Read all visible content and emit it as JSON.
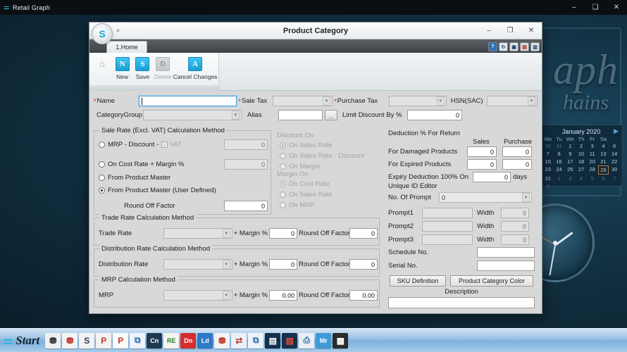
{
  "app_window": {
    "title": "Retail Graph",
    "icon": "app-logo-icon",
    "minimize": "–",
    "maximize": "❑",
    "close": "✕"
  },
  "dialog": {
    "title": "Product Category",
    "logo": "S",
    "qat_icon": "▾undefined",
    "qat": "≡",
    "minimize": "–",
    "maximize": "❐",
    "close": "✕",
    "tab": "1.Home",
    "tab_icons": [
      "help-icon",
      "refresh-icon",
      "save-icon",
      "report-icon",
      "window-icon"
    ],
    "tab_icon_labels": [
      "?",
      "↻",
      "▣",
      "▤",
      "▥"
    ]
  },
  "ribbon": {
    "home_icon": "⌂",
    "buttons": [
      {
        "glyph": "N",
        "label": "New",
        "disabled": false
      },
      {
        "glyph": "S",
        "label": "Save",
        "disabled": false
      },
      {
        "glyph": "D",
        "label": "Delete",
        "disabled": true
      },
      {
        "glyph": "A",
        "label": "Cancel Changes",
        "disabled": false
      }
    ]
  },
  "form": {
    "name": {
      "label": "Name",
      "value": "",
      "required": true
    },
    "sale_tax": {
      "label": "Sale Tax",
      "value": "",
      "required": true
    },
    "purchase_tax": {
      "label": "Purchase Tax",
      "value": "",
      "required": true
    },
    "hsn_sac": {
      "label": "HSN(SAC)",
      "value": ""
    },
    "category_group": {
      "label": "CategoryGroup",
      "value": ""
    },
    "alias": {
      "label": "Alias",
      "value": "",
      "browse": "..."
    },
    "limit_discount": {
      "label": "Limit Discount By %",
      "value": "0"
    }
  },
  "sale_rate": {
    "title": "Sale Rate (Excl. VAT) Calculation Method",
    "options": [
      {
        "label": "MRP - Discount -",
        "selected": false,
        "has_checkbox": true,
        "checkbox_label": "VAT",
        "checkbox_checked": true,
        "value": "0"
      },
      {
        "label": "On Cost Rate + Margin %",
        "selected": false,
        "value": "0"
      },
      {
        "label": "From Product Master",
        "selected": false
      },
      {
        "label": "From Product Master (User Defined)",
        "selected": true
      }
    ],
    "round_off": {
      "label": "Round Off Factor",
      "value": "0"
    }
  },
  "discount_on": {
    "title": "Discount On",
    "disabled": true,
    "options": [
      {
        "label": "On Sales Rate",
        "selected": true
      },
      {
        "label": "On Sales Rate - Discount",
        "selected": false
      },
      {
        "label": "On Margin",
        "selected": false
      }
    ]
  },
  "margin_on": {
    "title": "Margin On",
    "disabled": true,
    "options": [
      {
        "label": "On Cost Rate",
        "selected": true
      },
      {
        "label": "On Sales Rate",
        "selected": false
      },
      {
        "label": "On MRP",
        "selected": false
      }
    ]
  },
  "deduction": {
    "title": "Deduction % For Return",
    "col_sales": "Sales",
    "col_purchase": "Purchase",
    "rows": [
      {
        "label": "For Damaged Products",
        "sales": "0",
        "purchase": "0"
      },
      {
        "label": "For Expired Products",
        "sales": "0",
        "purchase": "0"
      }
    ],
    "expiry": {
      "label": "Expiry Deduction 100% On",
      "value": "0",
      "suffix": "days"
    }
  },
  "unique_id": {
    "title": "Unique ID Editor",
    "no_of_prompt": {
      "label": "No. Of Prompt",
      "value": "0"
    },
    "prompts": [
      {
        "label": "Prompt1",
        "value": "",
        "width_label": "Width",
        "width_value": "0"
      },
      {
        "label": "Prompt2",
        "value": "",
        "width_label": "Width",
        "width_value": "0"
      },
      {
        "label": "Prompt3",
        "value": "",
        "width_label": "Width",
        "width_value": "0"
      }
    ]
  },
  "misc": {
    "schedule_no": {
      "label": "Schedule No.",
      "value": ""
    },
    "serial_no": {
      "label": "Serial No.",
      "value": ""
    },
    "sku_definition": "SKU Definition",
    "product_category_color": "Product Category Color",
    "description_label": "Description",
    "description_value": ""
  },
  "trade_rate": {
    "title": "Trade Rate Calculation Method",
    "label": "Trade Rate",
    "combo": "",
    "margin_label": "+ Margin %",
    "margin_value": "0",
    "round_label": "Round Off Factor",
    "round_value": "0"
  },
  "distribution_rate": {
    "title": "Distribution Rate Calculation Method",
    "label": "Distribution Rate",
    "combo": "",
    "margin_label": "+ Margin %",
    "margin_value": "0",
    "round_label": "Round Off Factor",
    "round_value": "0"
  },
  "mrp_rate": {
    "title": "MRP Calculation Method",
    "label": "MRP",
    "combo": "",
    "margin_label": "+ Margin %",
    "margin_value": "0.00",
    "round_label": "Round Off Factor",
    "round_value": "0.00"
  },
  "desktop": {
    "wallpaper_line1": "aph",
    "wallpaper_line2": "hains",
    "calendar": {
      "month_year": "January  2020",
      "next": "▶",
      "dow": [
        "Mo",
        "Tu",
        "We",
        "Th",
        "Fr",
        "Sa"
      ],
      "weeks": [
        [
          {
            "d": "30",
            "t": "out"
          },
          {
            "d": "31",
            "t": "out"
          },
          {
            "d": "1",
            "t": ""
          },
          {
            "d": "2",
            "t": ""
          },
          {
            "d": "3",
            "t": ""
          },
          {
            "d": "4",
            "t": ""
          }
        ],
        [
          {
            "d": "6",
            "t": ""
          },
          {
            "d": "7",
            "t": ""
          },
          {
            "d": "8",
            "t": ""
          },
          {
            "d": "9",
            "t": ""
          },
          {
            "d": "10",
            "t": ""
          },
          {
            "d": "11",
            "t": ""
          }
        ],
        [
          {
            "d": "13",
            "t": ""
          },
          {
            "d": "14",
            "t": ""
          },
          {
            "d": "15",
            "t": ""
          },
          {
            "d": "16",
            "t": ""
          },
          {
            "d": "17",
            "t": ""
          },
          {
            "d": "18",
            "t": ""
          }
        ],
        [
          {
            "d": "20",
            "t": ""
          },
          {
            "d": "21",
            "t": ""
          },
          {
            "d": "22",
            "t": ""
          },
          {
            "d": "23",
            "t": ""
          },
          {
            "d": "24",
            "t": ""
          },
          {
            "d": "25",
            "t": ""
          }
        ],
        [
          {
            "d": "27",
            "t": ""
          },
          {
            "d": "28",
            "t": ""
          },
          {
            "d": "29",
            "t": "today"
          },
          {
            "d": "30",
            "t": ""
          },
          {
            "d": "31",
            "t": ""
          },
          {
            "d": "1",
            "t": "out"
          }
        ],
        [
          {
            "d": "3",
            "t": "out"
          },
          {
            "d": "4",
            "t": "out"
          },
          {
            "d": "5",
            "t": "out"
          },
          {
            "d": "6",
            "t": "out"
          },
          {
            "d": "7",
            "t": "out"
          },
          {
            "d": "8",
            "t": "out"
          }
        ]
      ]
    }
  },
  "taskbar": {
    "start_label": "Start",
    "start_icon": "start-logo-icon",
    "icons": [
      {
        "name": "cart-purchase-icon",
        "glyph": "⛃",
        "bg": "#f0f0f0",
        "fg": "#333"
      },
      {
        "name": "cart-sale-icon",
        "glyph": "⛃",
        "bg": "#f3f3f3",
        "fg": "#c0392b"
      },
      {
        "name": "sale-s-icon",
        "glyph": "S",
        "bg": "#f2f2f2",
        "fg": "#2c3e50"
      },
      {
        "name": "purchase-p-icon",
        "glyph": "P",
        "bg": "#f2f2f2",
        "fg": "#c0392b"
      },
      {
        "name": "purchase-order-icon",
        "glyph": "P",
        "bg": "#fafafa",
        "fg": "#c0392b"
      },
      {
        "name": "copy-doc-icon",
        "glyph": "⧉",
        "bg": "#eef3f8",
        "fg": "#2f6fb5"
      },
      {
        "name": "credit-note-icon",
        "glyph": "Cn",
        "bg": "#1d3a52",
        "fg": "#fff"
      },
      {
        "name": "receipt-icon",
        "glyph": "RE",
        "bg": "#f5f5ef",
        "fg": "#2e7d32"
      },
      {
        "name": "debit-note-icon",
        "glyph": "Dn",
        "bg": "#d32f2f",
        "fg": "#fff"
      },
      {
        "name": "ledger-icon",
        "glyph": "Ld",
        "bg": "#2f79c6",
        "fg": "#fff"
      },
      {
        "name": "sale-return-icon",
        "glyph": "⛃",
        "bg": "#f3f3f3",
        "fg": "#c0392b"
      },
      {
        "name": "exchange-icon",
        "glyph": "⇄",
        "bg": "#eaf1f8",
        "fg": "#c0392b"
      },
      {
        "name": "documents-icon",
        "glyph": "⧉",
        "bg": "#eef3f8",
        "fg": "#2f6fb5"
      },
      {
        "name": "book-sale-icon",
        "glyph": "▤",
        "bg": "#14304a",
        "fg": "#fff"
      },
      {
        "name": "book-purchase-icon",
        "glyph": "▤",
        "bg": "#14304a",
        "fg": "#e74c3c"
      },
      {
        "name": "printer-icon",
        "glyph": "⎙",
        "bg": "#e9eff5",
        "fg": "#2f6fb5"
      },
      {
        "name": "master-icon",
        "glyph": "Mr",
        "bg": "#3f9ad6",
        "fg": "#fff"
      },
      {
        "name": "calculator-icon",
        "glyph": "▦",
        "bg": "#2b2b2b",
        "fg": "#fff"
      }
    ]
  }
}
